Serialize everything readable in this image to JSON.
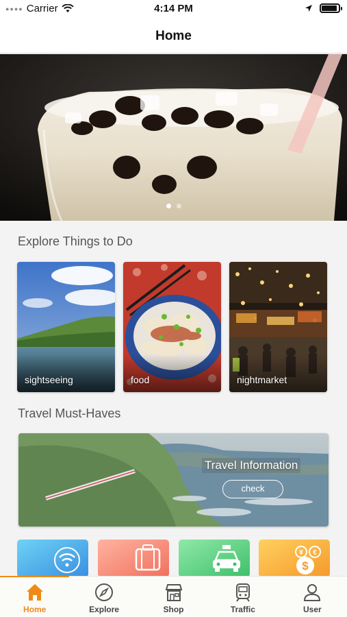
{
  "status_bar": {
    "carrier": "Carrier",
    "time": "4:14 PM"
  },
  "nav": {
    "title": "Home"
  },
  "hero": {
    "page_count": 2,
    "active_page": 1
  },
  "explore": {
    "title": "Explore Things to Do",
    "cards": [
      {
        "label": "sightseeing"
      },
      {
        "label": "food"
      },
      {
        "label": "nightmarket"
      }
    ]
  },
  "must_haves": {
    "title": "Travel Must-Haves",
    "banner_title": "Travel Information",
    "check_label": "check"
  },
  "shortcuts": [
    {
      "icon": "wifi-icon",
      "color": "#4aa8e8"
    },
    {
      "icon": "luggage-icon",
      "color": "#f58a7a"
    },
    {
      "icon": "taxi-icon",
      "color": "#5fd38a"
    },
    {
      "icon": "currency-exchange-icon",
      "color": "#f7b43a"
    }
  ],
  "tabs": [
    {
      "label": "Home",
      "icon": "home-icon",
      "active": true
    },
    {
      "label": "Explore",
      "icon": "compass-icon",
      "active": false
    },
    {
      "label": "Shop",
      "icon": "shop-icon",
      "active": false
    },
    {
      "label": "Traffic",
      "icon": "train-icon",
      "active": false
    },
    {
      "label": "User",
      "icon": "user-icon",
      "active": false
    }
  ],
  "colors": {
    "accent": "#f08a17",
    "background": "#f3f3f3"
  }
}
